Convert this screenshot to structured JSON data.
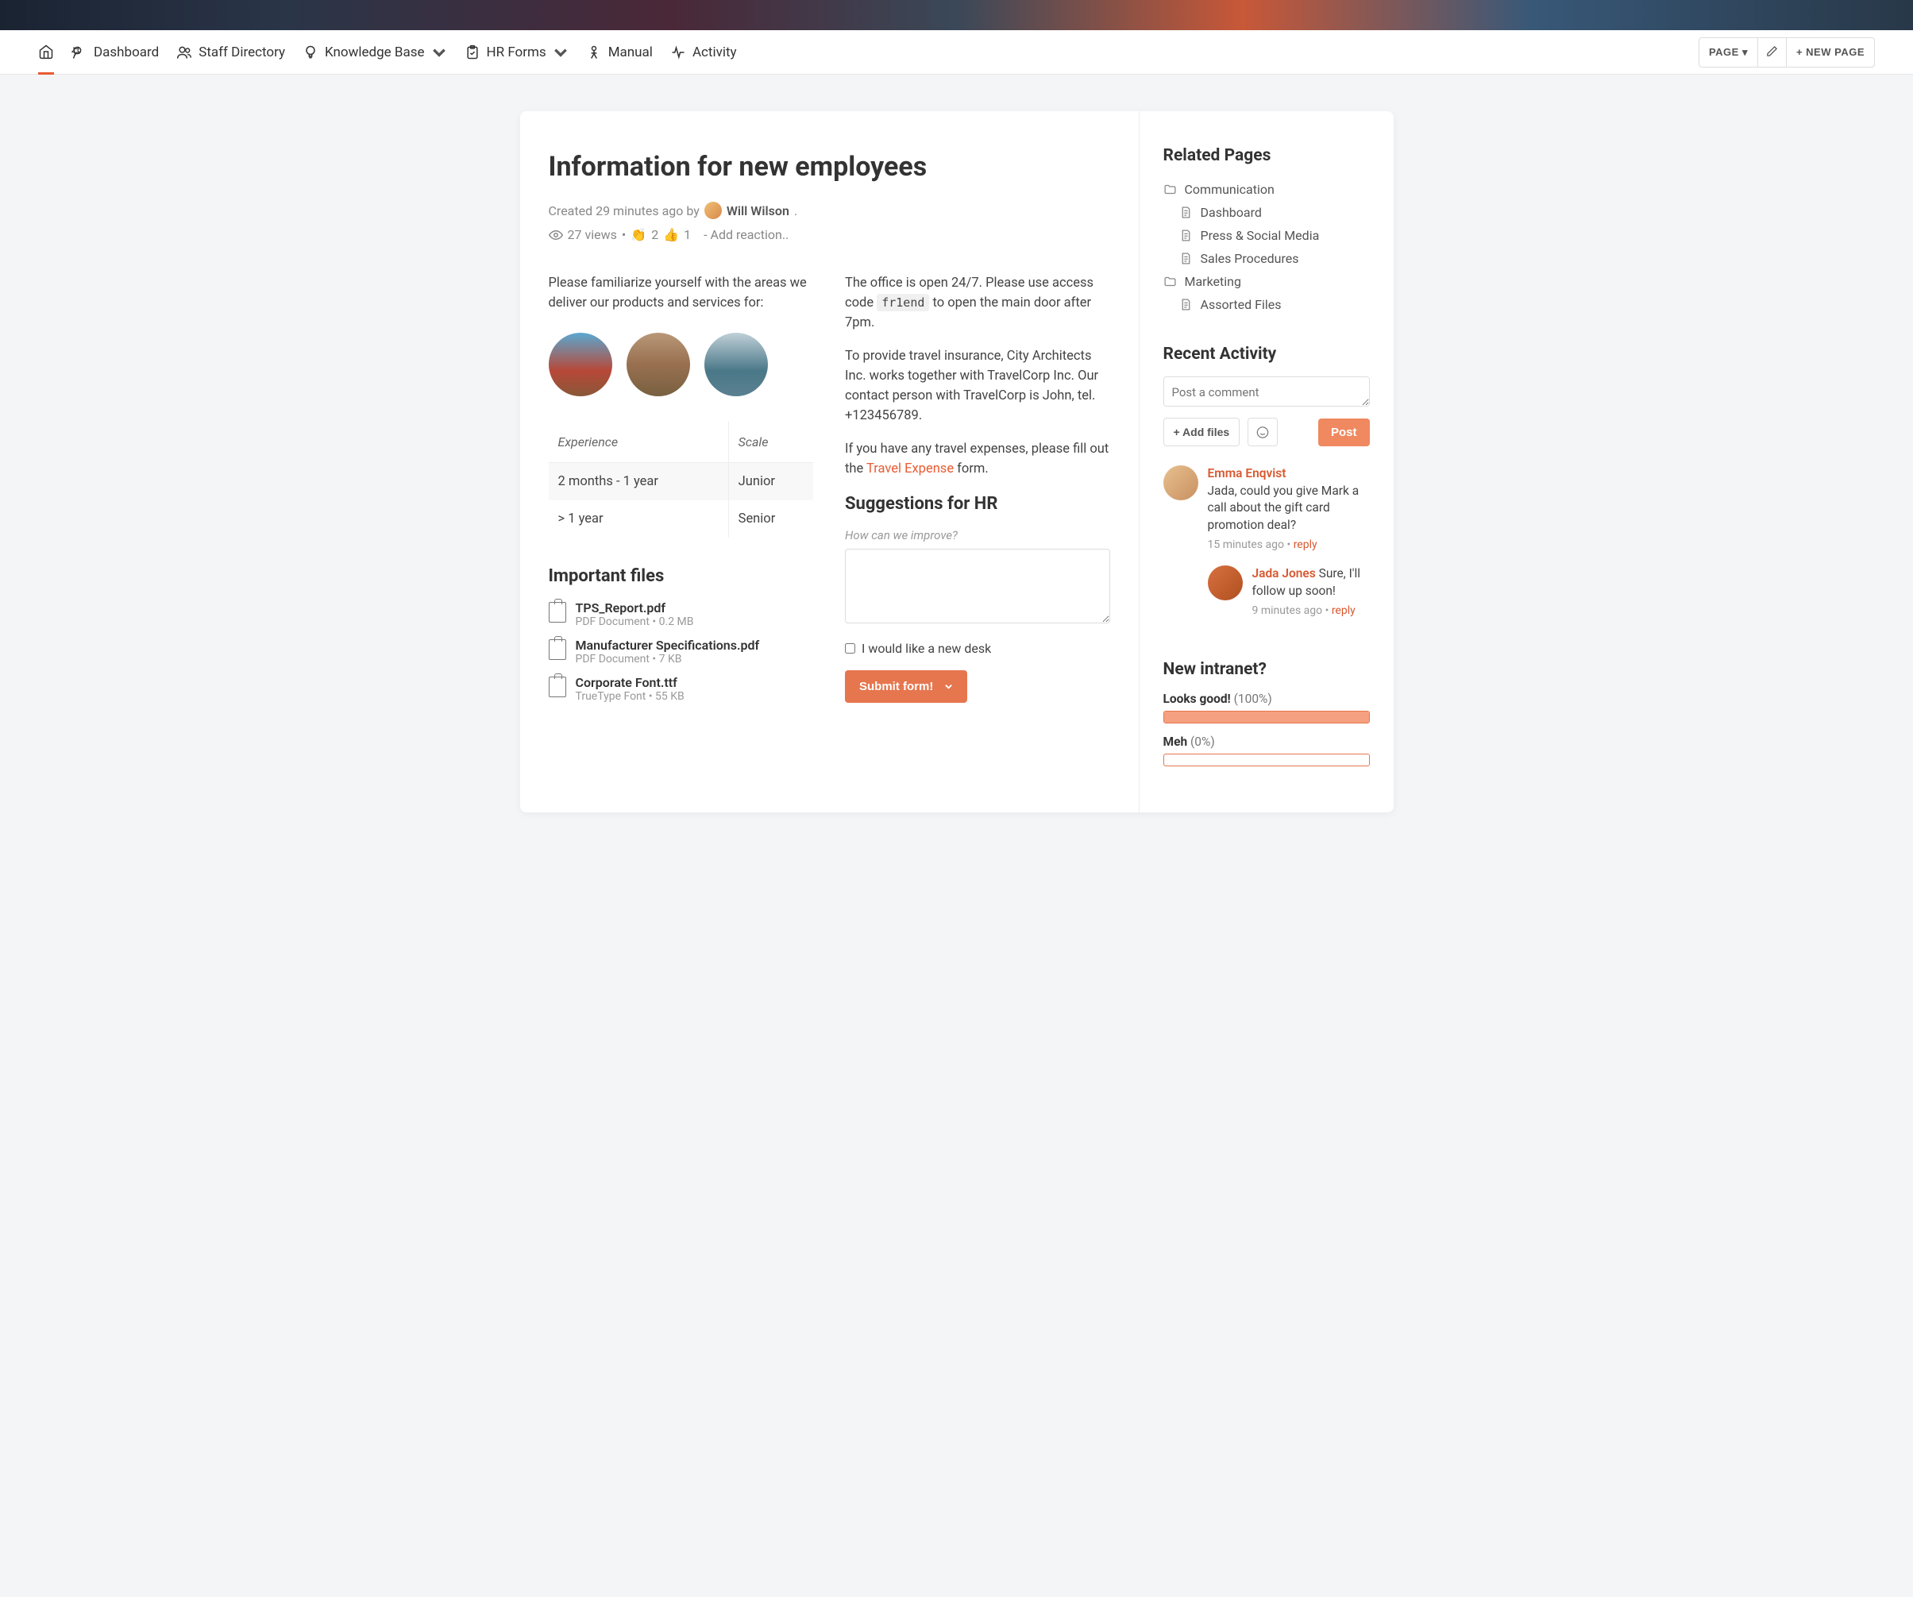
{
  "nav": {
    "items": [
      "Dashboard",
      "Staff Directory",
      "Knowledge Base",
      "HR Forms",
      "Manual",
      "Activity"
    ],
    "page_btn": "PAGE ▾",
    "new_page_btn": "+ NEW PAGE"
  },
  "page": {
    "title": "Information for new employees",
    "created_prefix": "Created 29 minutes ago by",
    "author": "Will Wilson",
    "views": "27 views",
    "reaction_clap": "2",
    "reaction_thumbs": "1",
    "add_reaction": "- Add reaction.."
  },
  "left": {
    "intro": "Please familiarize yourself with the areas we deliver our products and services for:",
    "table": {
      "h1": "Experience",
      "h2": "Scale",
      "r1c1": "2 months - 1 year",
      "r1c2": "Junior",
      "r2c1": "> 1 year",
      "r2c2": "Senior"
    },
    "files_heading": "Important files",
    "files": [
      {
        "name": "TPS_Report.pdf",
        "meta": "PDF Document • 0.2 MB"
      },
      {
        "name": "Manufacturer Specifications.pdf",
        "meta": "PDF Document • 7 KB"
      },
      {
        "name": "Corporate Font.ttf",
        "meta": "TrueType Font • 55 KB"
      }
    ]
  },
  "right": {
    "p1a": "The office is open 24/7. Please use access code ",
    "p1code": "fr1end",
    "p1b": " to open the main door after 7pm.",
    "p2": "To provide travel insurance, City Architects Inc. works together with TravelCorp Inc. Our contact person with TravelCorp is John, tel. +123456789.",
    "p3a": "If you have any travel expenses, please fill out the ",
    "p3link": "Travel Expense",
    "p3b": " form.",
    "sugg_heading": "Suggestions for HR",
    "sugg_hint": "How can we improve?",
    "checkbox_label": "I would like a new desk",
    "submit": "Submit form!"
  },
  "sidebar": {
    "related_heading": "Related Pages",
    "related": [
      {
        "type": "folder",
        "label": "Communication"
      },
      {
        "type": "file",
        "label": "Dashboard",
        "child": true
      },
      {
        "type": "file",
        "label": "Press & Social Media",
        "child": true
      },
      {
        "type": "file",
        "label": "Sales Procedures",
        "child": true
      },
      {
        "type": "folder",
        "label": "Marketing"
      },
      {
        "type": "file",
        "label": "Assorted Files",
        "child": true
      }
    ],
    "activity_heading": "Recent Activity",
    "comment_placeholder": "Post a comment",
    "add_files": "+ Add files",
    "post": "Post",
    "activity1": {
      "name": "Emma Enqvist",
      "text": "Jada, could you give Mark a call about the gift card promotion deal?",
      "time": "15 minutes ago",
      "reply": "reply"
    },
    "activity2": {
      "name": "Jada Jones",
      "text": "Sure, I'll follow up soon!",
      "time": "9 minutes ago",
      "reply": "reply"
    },
    "poll_heading": "New intranet?",
    "poll1_label": "Looks good!",
    "poll1_pct": "(100%)",
    "poll1_fill": 100,
    "poll2_label": "Meh",
    "poll2_pct": "(0%)",
    "poll2_fill": 0
  }
}
